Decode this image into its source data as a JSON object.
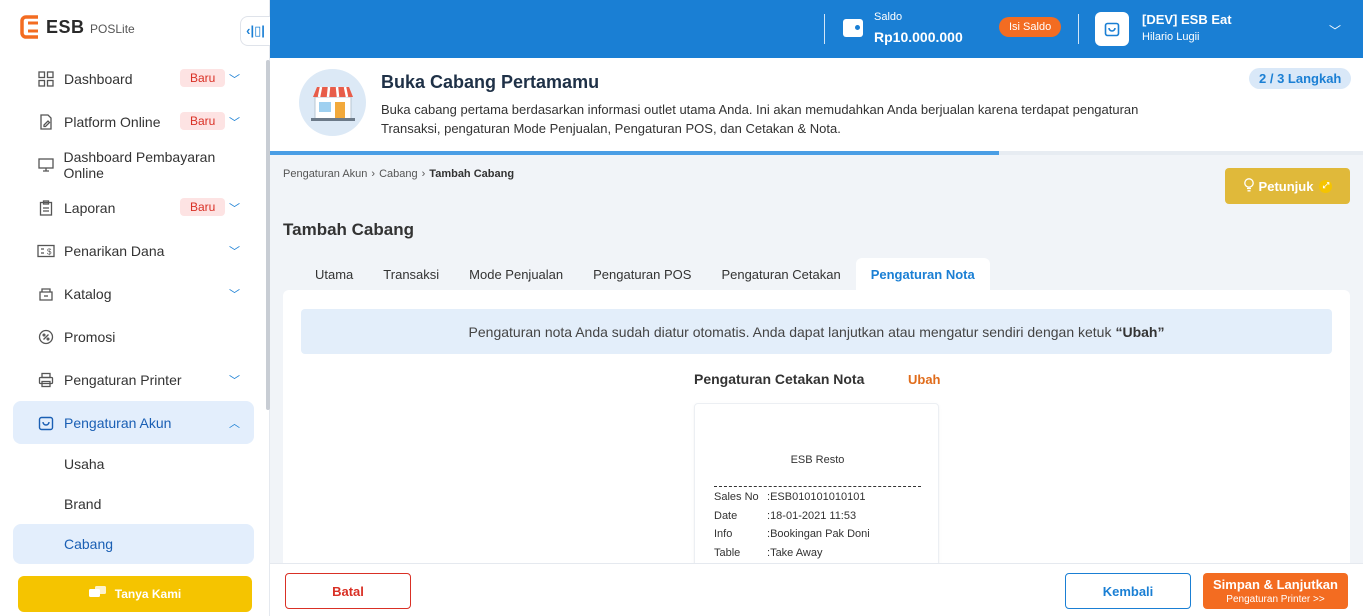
{
  "brand": {
    "logo_main": "ESB",
    "logo_sub": "POSLite"
  },
  "sidebar": {
    "items": [
      {
        "label": "Dashboard",
        "icon": "grid-icon",
        "badge": "Baru",
        "chevron": "down"
      },
      {
        "label": "Platform Online",
        "icon": "document-pen-icon",
        "badge": "Baru",
        "chevron": "down"
      },
      {
        "label": "Dashboard Pembayaran Online",
        "icon": "monitor-icon",
        "badge": "",
        "chevron": ""
      },
      {
        "label": "Laporan",
        "icon": "clipboard-icon",
        "badge": "Baru",
        "chevron": "down"
      },
      {
        "label": "Penarikan Dana",
        "icon": "cash-icon",
        "badge": "",
        "chevron": "down"
      },
      {
        "label": "Katalog",
        "icon": "box-icon",
        "badge": "",
        "chevron": "down"
      },
      {
        "label": "Promosi",
        "icon": "percent-icon",
        "badge": "",
        "chevron": ""
      },
      {
        "label": "Pengaturan Printer",
        "icon": "printer-icon",
        "badge": "",
        "chevron": "down"
      },
      {
        "label": "Pengaturan Akun",
        "icon": "store-icon",
        "badge": "",
        "chevron": "up"
      }
    ],
    "sub_items": [
      "Usaha",
      "Brand",
      "Cabang"
    ],
    "tanya_label": "Tanya Kami"
  },
  "topbar": {
    "saldo_label": "Saldo",
    "saldo_value": "Rp10.000.000",
    "isi_saldo": "Isi Saldo",
    "store_name": "[DEV] ESB Eat",
    "user_name": "Hilario Lugii"
  },
  "banner": {
    "title": "Buka Cabang Pertamamu",
    "description": "Buka cabang pertama berdasarkan informasi outlet utama Anda. Ini akan memudahkan Anda berjualan karena terdapat pengaturan Transaksi, pengaturan Mode Penjualan, Pengaturan POS, dan Cetakan & Nota.",
    "step": "2 / 3 Langkah",
    "progress_percent": 66.7
  },
  "breadcrumb": [
    "Pengaturan Akun",
    "Cabang",
    "Tambah Cabang"
  ],
  "petunjuk_label": "Petunjuk",
  "page_title": "Tambah Cabang",
  "tabs": [
    "Utama",
    "Transaksi",
    "Mode Penjualan",
    "Pengaturan POS",
    "Pengaturan Cetakan",
    "Pengaturan Nota"
  ],
  "active_tab": 5,
  "info": {
    "text": "Pengaturan nota Anda sudah diatur otomatis. Anda dapat lanjutkan atau mengatur sendiri dengan ketuk",
    "highlight": "“Ubah”"
  },
  "nota": {
    "title": "Pengaturan Cetakan Nota",
    "edit_label": "Ubah",
    "receipt": {
      "store": "ESB Resto",
      "rows": [
        {
          "key": "Sales No",
          "value": "ESB010101010101"
        },
        {
          "key": "Date",
          "value": "18-01-2021 11:53"
        },
        {
          "key": "Info",
          "value": "Bookingan Pak Doni"
        },
        {
          "key": "Table",
          "value": "Take Away"
        }
      ]
    }
  },
  "footer": {
    "batal": "Batal",
    "kembali": "Kembali",
    "simpan": "Simpan & Lanjutkan",
    "simpan_sub": "Pengaturan Printer >>"
  },
  "colors": {
    "primary": "#1a7fd4",
    "accent": "#f36c21",
    "warning": "#f5c400",
    "danger": "#d93025"
  }
}
